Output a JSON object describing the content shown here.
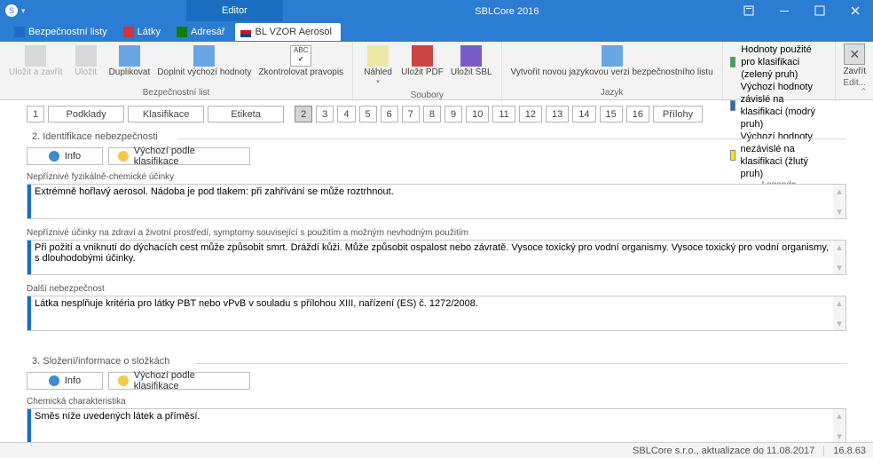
{
  "title": {
    "editor": "Editor",
    "app": "SBLCore 2016"
  },
  "subtabs": [
    {
      "label": "Bezpečnostní listy"
    },
    {
      "label": "Látky"
    },
    {
      "label": "Adresář"
    },
    {
      "label": "BL VZOR Aerosol"
    }
  ],
  "ribbon": {
    "groups": {
      "bl": {
        "label": "Bezpečnostní list",
        "btns": {
          "ulozit_zavrit": "Uložit a\nzavřít",
          "ulozit": "Uložit",
          "duplikovat": "Duplikovat",
          "doplnit": "Doplnit výchozí\nhodnoty",
          "spell": "Zkontrolovat\npravopis"
        }
      },
      "soubory": {
        "label": "Soubory",
        "btns": {
          "nahled": "Náhled",
          "pdf": "Uložit\nPDF",
          "sbl": "Uložit\nSBL"
        }
      },
      "jazyk": {
        "label": "Jazyk",
        "btns": {
          "novy": "Vytvořit novou jazykovou\nverzi bezpečnostního listu"
        }
      },
      "legenda": {
        "label": "Legenda",
        "rows": [
          {
            "color": "#26b050",
            "text": "Hodnoty použité pro klasifikaci (zelený pruh)"
          },
          {
            "color": "#1b6ec2",
            "text": "Výchozí hodnoty závislé na klasifikaci (modrý pruh)"
          },
          {
            "color": "#ffe600",
            "text": "Výchozí hodnoty nezávislé na klasifikaci (žlutý pruh)"
          }
        ]
      },
      "edit": {
        "label": "Edit...",
        "close": "Zavřít"
      }
    }
  },
  "nav": {
    "sections": [
      "1",
      "Podklady",
      "Klasifikace",
      "Etiketa"
    ],
    "pages": [
      "2",
      "3",
      "4",
      "5",
      "6",
      "7",
      "8",
      "9",
      "10",
      "11",
      "12",
      "13",
      "14",
      "15",
      "16",
      "Přílohy"
    ],
    "active": "2"
  },
  "sec2": {
    "heading": "2. Identifikace nebezpečnosti",
    "info": "Info",
    "vychozi": "Výchozí podle klasifikace",
    "f1": {
      "label": "Nepříznivé fyzikálně-chemické účinky",
      "value": "Extrémně hořlavý aerosol. Nádoba je pod tlakem: při zahřívání se může roztrhnout."
    },
    "f2": {
      "label": "Nepříznivé účinky na zdraví a životní prostředí, symptomy související s použitím a možným nevhodným použitím",
      "value": "Při požití a vniknutí do dýchacích cest může způsobit smrt. Dráždí kůži. Může způsobit ospalost nebo závratě. Vysoce toxický pro vodní organismy. Vysoce toxický pro vodní organismy, s dlouhodobými účinky."
    },
    "f3": {
      "label": "Další nebezpečnost",
      "value": "Látka nesplňuje kritéria pro látky PBT nebo vPvB v souladu s přílohou XIII, nařízení (ES) č. 1272/2008."
    }
  },
  "sec3": {
    "heading": "3. Složení/informace o složkách",
    "info": "Info",
    "vychozi": "Výchozí podle klasifikace",
    "f1": {
      "label": "Chemická charakteristika",
      "value": "Směs níže uvedených látek a příměsí."
    }
  },
  "status": {
    "left": "SBLCore s.r.o., aktualizace do 11.08.2017",
    "ver": "16.8.63"
  }
}
